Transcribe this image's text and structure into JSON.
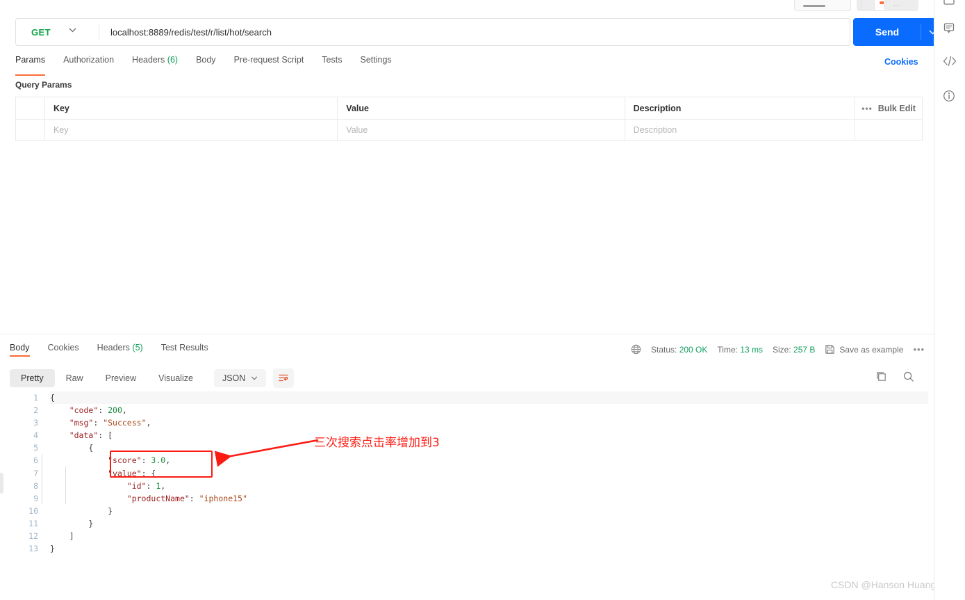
{
  "request": {
    "method": "GET",
    "url": "localhost:8889/redis/test/r/list/hot/search",
    "send_label": "Send",
    "cookies_label": "Cookies",
    "tabs": [
      {
        "label": "Params",
        "count": "",
        "active": true
      },
      {
        "label": "Authorization",
        "count": "",
        "active": false
      },
      {
        "label": "Headers",
        "count": "(6)",
        "active": false
      },
      {
        "label": "Body",
        "count": "",
        "active": false
      },
      {
        "label": "Pre-request Script",
        "count": "",
        "active": false
      },
      {
        "label": "Tests",
        "count": "",
        "active": false
      },
      {
        "label": "Settings",
        "count": "",
        "active": false
      }
    ]
  },
  "query_params": {
    "title": "Query Params",
    "headers": {
      "key": "Key",
      "value": "Value",
      "description": "Description"
    },
    "bulk_edit_label": "Bulk Edit",
    "rows": [
      {
        "key_placeholder": "Key",
        "value_placeholder": "Value",
        "description_placeholder": "Description"
      }
    ]
  },
  "response": {
    "tabs": [
      {
        "label": "Body",
        "count": "",
        "active": true
      },
      {
        "label": "Cookies",
        "count": "",
        "active": false
      },
      {
        "label": "Headers",
        "count": "(5)",
        "active": false
      },
      {
        "label": "Test Results",
        "count": "",
        "active": false
      }
    ],
    "status": {
      "status_label": "Status:",
      "status_value": "200 OK",
      "time_label": "Time:",
      "time_value": "13 ms",
      "size_label": "Size:",
      "size_value": "257 B",
      "save_example_label": "Save as example"
    },
    "view_modes": [
      {
        "label": "Pretty",
        "active": true
      },
      {
        "label": "Raw",
        "active": false
      },
      {
        "label": "Preview",
        "active": false
      },
      {
        "label": "Visualize",
        "active": false
      }
    ],
    "format": "JSON",
    "line_numbers": [
      "1",
      "2",
      "3",
      "4",
      "5",
      "6",
      "7",
      "8",
      "9",
      "10",
      "11",
      "12",
      "13"
    ],
    "body_lines": [
      [
        {
          "t": "{",
          "c": "p"
        }
      ],
      [
        {
          "t": "    ",
          "c": "p"
        },
        {
          "t": "\"code\"",
          "c": "k"
        },
        {
          "t": ": ",
          "c": "p"
        },
        {
          "t": "200",
          "c": "num"
        },
        {
          "t": ",",
          "c": "p"
        }
      ],
      [
        {
          "t": "    ",
          "c": "p"
        },
        {
          "t": "\"msg\"",
          "c": "k"
        },
        {
          "t": ": ",
          "c": "p"
        },
        {
          "t": "\"Success\"",
          "c": "str"
        },
        {
          "t": ",",
          "c": "p"
        }
      ],
      [
        {
          "t": "    ",
          "c": "p"
        },
        {
          "t": "\"data\"",
          "c": "k"
        },
        {
          "t": ": [",
          "c": "p"
        }
      ],
      [
        {
          "t": "        {",
          "c": "p"
        }
      ],
      [
        {
          "t": "            ",
          "c": "p"
        },
        {
          "t": "\"score\"",
          "c": "k"
        },
        {
          "t": ": ",
          "c": "p"
        },
        {
          "t": "3.0",
          "c": "num"
        },
        {
          "t": ",",
          "c": "p"
        }
      ],
      [
        {
          "t": "            ",
          "c": "p"
        },
        {
          "t": "\"value\"",
          "c": "k"
        },
        {
          "t": ": {",
          "c": "p"
        }
      ],
      [
        {
          "t": "                ",
          "c": "p"
        },
        {
          "t": "\"id\"",
          "c": "k"
        },
        {
          "t": ": ",
          "c": "p"
        },
        {
          "t": "1",
          "c": "num"
        },
        {
          "t": ",",
          "c": "p"
        }
      ],
      [
        {
          "t": "                ",
          "c": "p"
        },
        {
          "t": "\"productName\"",
          "c": "k"
        },
        {
          "t": ": ",
          "c": "p"
        },
        {
          "t": "\"iphone15\"",
          "c": "str"
        }
      ],
      [
        {
          "t": "            }",
          "c": "p"
        }
      ],
      [
        {
          "t": "        }",
          "c": "p"
        }
      ],
      [
        {
          "t": "    ]",
          "c": "p"
        }
      ],
      [
        {
          "t": "}",
          "c": "p"
        }
      ]
    ]
  },
  "annotation": {
    "text": "三次搜索点击率增加到3",
    "color": "#fc1b12"
  },
  "watermark": "CSDN @Hanson Huang",
  "colors": {
    "accent_orange": "#ff6c37",
    "send_blue": "#0a6cff",
    "method_green": "#10a54a",
    "status_green": "#14a05e",
    "annotation_red": "#fc1b12"
  }
}
